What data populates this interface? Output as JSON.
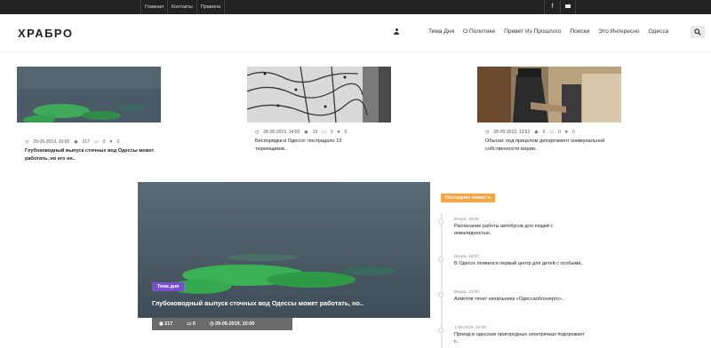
{
  "topbar": {
    "links": [
      "Главная",
      "Контакты",
      "Правила"
    ],
    "social": {
      "facebook": "f",
      "email_icon": "mail-icon"
    }
  },
  "header": {
    "logo": "ХРАБРО",
    "nav": [
      "Тема Дня",
      "О Политике",
      "Привет Из Прошлого",
      "Поиски",
      "Это Интересно",
      "Одесса"
    ]
  },
  "cards": [
    {
      "date": "29-05-2019, 10:00",
      "views": "217",
      "comments": "0",
      "likes": "0",
      "title": "Глубоководный выпуск сточных вод Одессы может работать, но его не..",
      "bold": true
    },
    {
      "date": "28-05-2019, 14:00",
      "views": "19",
      "comments": "0",
      "likes": "0",
      "title": "Беспорядки в Одессе: пострадало 13 тюремщиков..",
      "bold": false
    },
    {
      "date": "28-05-2019, 13:52",
      "views": "6",
      "comments": "0",
      "likes": "0",
      "title": "Обыски: под прицелом департамент коммунальной собственности мэрии..",
      "bold": false
    }
  ],
  "featured": {
    "badge": "Тема дня",
    "title": "Глубоководный выпуск сточных вод Одессы может работать, но..",
    "views": "217",
    "comments": "0",
    "date": "29-05-2019, 10:00"
  },
  "latest": {
    "heading": "Последние новости",
    "items": [
      {
        "time": "Вчера, 16:00",
        "title": "Расписание работы автобусов для людей с инвалидностью.."
      },
      {
        "time": "Вчера, 15:02",
        "title": "В Одессе появился первый центр для детей с особыми.."
      },
      {
        "time": "Вчера, 13:30",
        "title": "Ахметов тянет начальника «Одессаоблэнерго».."
      },
      {
        "time": "1-06-2019, 16:00",
        "title": "Проезд в одесских пригородных электричках подорожает с.."
      }
    ]
  },
  "colors": {
    "topbar": "#222222",
    "badge": "#7a4fd0",
    "latest_head": "#f5a447"
  }
}
